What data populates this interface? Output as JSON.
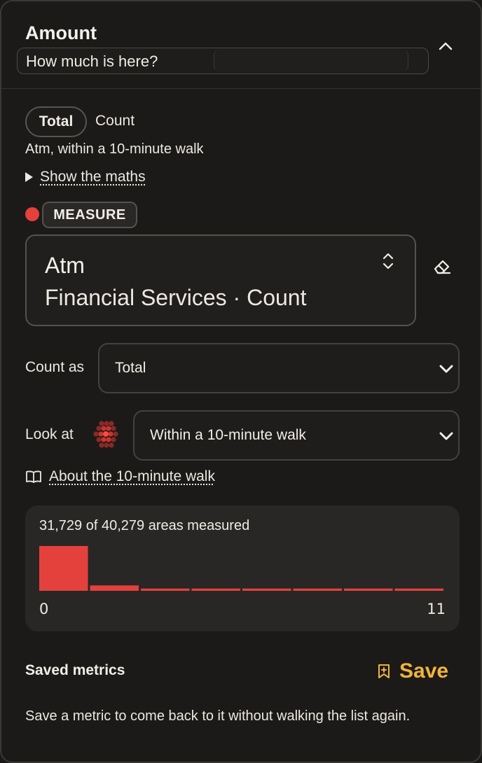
{
  "header": {
    "title": "Amount",
    "subtitle": "How much is here?"
  },
  "toggle": {
    "total_label": "Total",
    "count_label": "Count"
  },
  "description": "Atm, within a 10-minute walk",
  "maths_link": "Show the maths",
  "measure": {
    "tag": "MEASURE",
    "dot_color": "#e4413d",
    "name": "Atm",
    "sub": "Financial Services · Count"
  },
  "count_as": {
    "label": "Count as",
    "value": "Total"
  },
  "look_at": {
    "label": "Look at",
    "value": "Within a 10-minute walk"
  },
  "about_link": "About the 10-minute walk",
  "histogram": {
    "label": "31,729 of 40,279 areas measured",
    "axis_min": "0",
    "axis_max": "11",
    "bar_color": "#e4413d"
  },
  "chart_data": {
    "type": "bar",
    "title": "31,729 of 40,279 areas measured",
    "xlim": [
      0,
      11
    ],
    "bins": 8,
    "values": [
      1.0,
      0.12,
      0.05,
      0.05,
      0.05,
      0.05,
      0.05,
      0.05
    ],
    "value_unit": "relative frequency"
  },
  "saved": {
    "label": "Saved metrics",
    "save_label": "Save",
    "note": "Save a metric to come back to it without walking the list again."
  },
  "colors": {
    "accent": "#f0b53a",
    "background": "#1c1a18"
  }
}
